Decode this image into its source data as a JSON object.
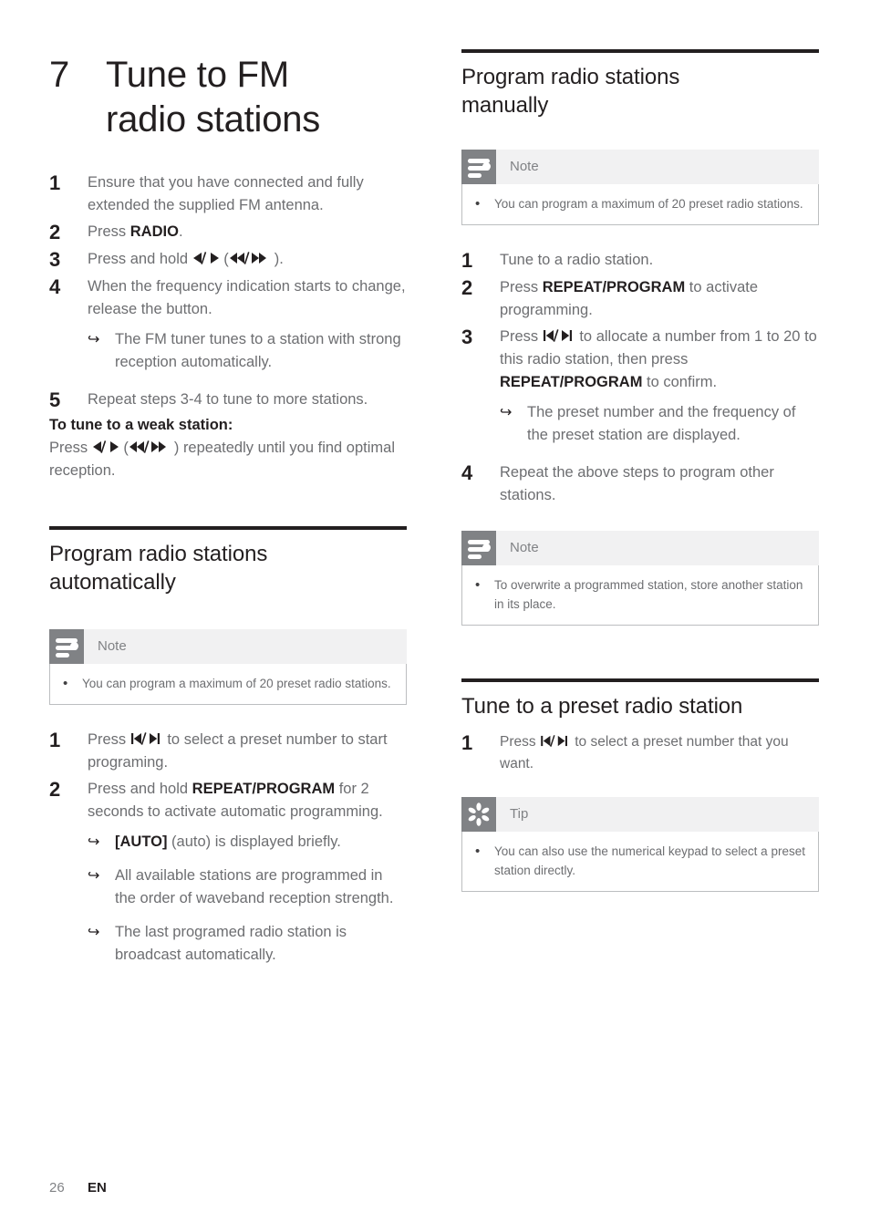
{
  "chapter": {
    "number": "7",
    "title_line1": "Tune to FM",
    "title_line2": "radio stations"
  },
  "left_column": {
    "intro_steps": [
      {
        "num": "1",
        "text": "Ensure that you have connected and fully extended the supplied FM antenna."
      },
      {
        "num": "2",
        "text_pre": "Press ",
        "bold": "RADIO",
        "text_post": "."
      },
      {
        "num": "3",
        "text_pre": "Press and hold ",
        "glyph1": "prev-next-arrows",
        "text_mid": " (",
        "glyph2": "rewind-forward-arrows",
        "text_post": ")."
      },
      {
        "num": "4",
        "text": "When the frequency indication starts to change, release the button."
      }
    ],
    "step4_result": "The FM tuner tunes to a station with strong reception automatically.",
    "step5": {
      "num": "5",
      "text": "Repeat steps 3-4 to tune to more stations."
    },
    "weak_station_heading": "To tune to a weak station:",
    "weak_station_pre": "Press ",
    "weak_station_mid": " (",
    "weak_station_post": ") repeatedly until you find optimal reception.",
    "section": {
      "heading_line1": "Program radio stations",
      "heading_line2": "automatically"
    },
    "note": {
      "icon": "note-icon",
      "title": "Note",
      "bullet": "•",
      "text": "You can program a maximum of 20 preset radio stations."
    },
    "auto_steps": [
      {
        "num": "1",
        "text_pre": "Press ",
        "glyph": "skip-back-forward",
        "text_post": " to select a preset number to start programing."
      },
      {
        "num": "2",
        "text_pre": "Press and hold ",
        "bold": "REPEAT/PROGRAM",
        "text_post": " for 2 seconds to activate automatic programming."
      }
    ],
    "auto_results": [
      {
        "bold": "[AUTO]",
        "text": " (auto) is displayed briefly."
      },
      {
        "text": "All available stations are programmed in the order of waveband reception strength."
      },
      {
        "text": "The last programed radio station is broadcast automatically."
      }
    ]
  },
  "right_column": {
    "section_manual": {
      "heading_line1": "Program radio stations",
      "heading_line2": "manually"
    },
    "note_manual": {
      "icon": "note-icon",
      "title": "Note",
      "bullet": "•",
      "text": "You can program a maximum of 20 preset radio stations."
    },
    "manual_steps": [
      {
        "num": "1",
        "text": "Tune to a radio station."
      },
      {
        "num": "2",
        "text_pre": "Press ",
        "bold": "REPEAT/PROGRAM",
        "text_post": " to activate programming."
      },
      {
        "num": "3",
        "text_pre": "Press ",
        "glyph": "skip-back-forward",
        "text_mid": " to allocate a number from 1 to 20 to this radio station, then press ",
        "bold": "REPEAT/PROGRAM",
        "text_post": " to confirm."
      }
    ],
    "manual_step3_result": "The preset number and the frequency of the preset station are displayed.",
    "manual_step4": {
      "num": "4",
      "text": "Repeat the above steps to program other stations."
    },
    "note_overwrite": {
      "icon": "note-icon",
      "title": "Note",
      "bullet": "•",
      "text": "To overwrite a programmed station, store another station in its place."
    },
    "section_preset": {
      "heading": "Tune to a preset radio station"
    },
    "preset_step": {
      "num": "1",
      "text_pre": "Press ",
      "glyph": "skip-back-forward",
      "text_post": " to select a preset number that you want."
    },
    "tip": {
      "icon": "tip-icon",
      "title": "Tip",
      "bullet": "•",
      "text": "You can also use the numerical keypad to select a preset station directly."
    }
  },
  "footer": {
    "page_number": "26",
    "language": "EN"
  },
  "colors": {
    "rule": "#231f20",
    "heading": "#231f20",
    "body": "#6d6e71",
    "callout_icon_bg": "#808285",
    "callout_head_bg": "#f1f1f2",
    "callout_border": "#bcbec0"
  }
}
